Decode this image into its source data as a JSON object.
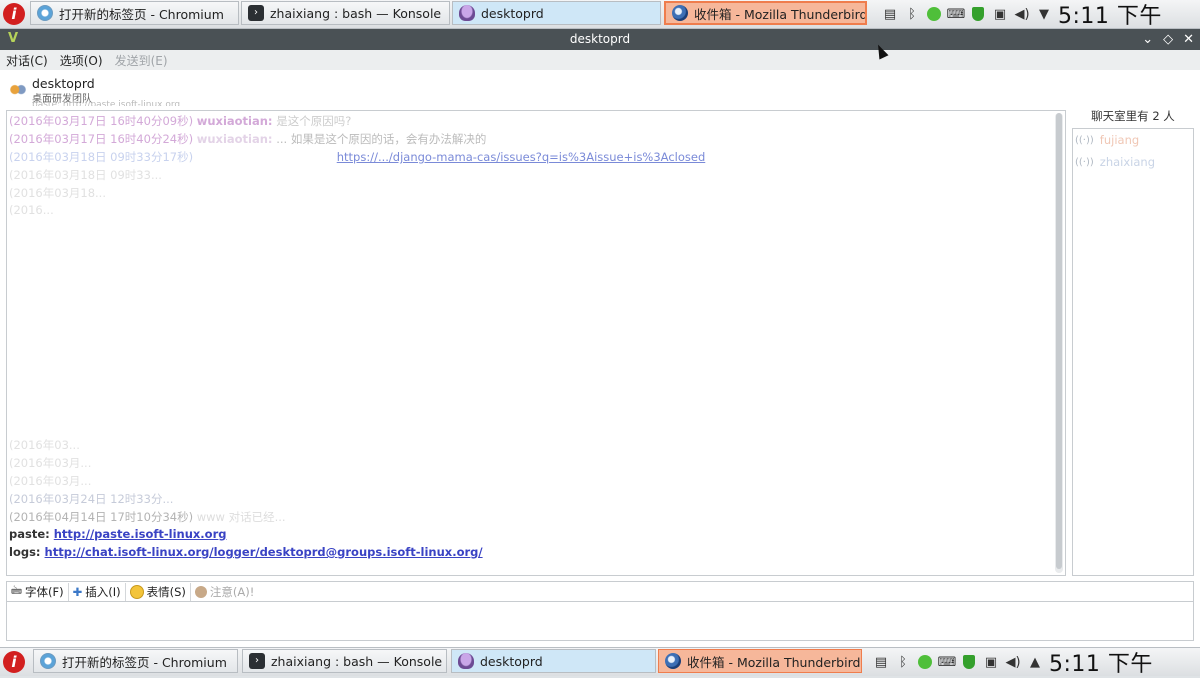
{
  "taskbar": {
    "tasks": [
      {
        "label": "打开新的标签页 - Chromium",
        "icon": "chromium-icon"
      },
      {
        "label": "zhaixiang : bash — Konsole",
        "icon": "konsole-icon"
      },
      {
        "label": "desktoprd",
        "icon": "pidgin-icon"
      },
      {
        "label": "收件箱 - Mozilla Thunderbird",
        "icon": "thunderbird-icon"
      }
    ],
    "clock": "5:11 下午",
    "start_icon": "isoft-start-icon",
    "tray_icons": [
      "clipboard-icon",
      "bluetooth-icon",
      "network-status-icon",
      "keyboard-icon",
      "shield-icon",
      "display-icon",
      "volume-icon",
      "tray-expand-icon"
    ]
  },
  "window": {
    "title": "desktoprd",
    "menu": [
      "对话(C)",
      "选项(O)",
      "发送到(E)"
    ]
  },
  "conversation": {
    "name": "desktoprd",
    "group": "桌面研发团队",
    "topic_partial": "paste: http://paste.isoft-linux.org"
  },
  "messages": [
    {
      "time": "(2016年03月17日 16时40分09秒)",
      "nick": "wuxiaotian:",
      "text": "是这个原因吗?"
    },
    {
      "time": "(2016年03月17日 16时40分24秒)",
      "nick": "wuxiaotian:",
      "text": "... 如果是这个原因的话，会有办法解决的"
    },
    {
      "time": "(2016年03月18日 09时33分17秒)",
      "nick": "",
      "text": "https://.../django-mama-cas/issues?q=is%3Aissue+is%3Aclosed"
    },
    {
      "time": "(2016年03月18日 09时33...",
      "nick": "",
      "text": ""
    },
    {
      "time": "(2016年03月18...",
      "nick": "",
      "text": ""
    },
    {
      "time": "(2016...",
      "nick": "",
      "text": ""
    }
  ],
  "messages_lower": [
    {
      "time": "(2016年03...",
      "text": ""
    },
    {
      "time": "(2016年03月...",
      "text": ""
    },
    {
      "time": "(2016年03月...",
      "text": ""
    },
    {
      "time": "(2016年03月24日 12时33分...",
      "text": ""
    },
    {
      "time": "(2016年04月14日 17时10分34秒)",
      "text": "www 对话已经..."
    }
  ],
  "info": {
    "paste_label": "paste:",
    "paste_url": "http://paste.isoft-linux.org",
    "logs_label": "logs:",
    "logs_url": "http://chat.isoft-linux.org/logger/desktoprd@groups.isoft-linux.org/"
  },
  "roster": {
    "header": "聊天室里有 2 人",
    "members": [
      "fujiang",
      "zhaixiang"
    ]
  },
  "compose_toolbar": {
    "font": "字体(F)",
    "insert": "插入(I)",
    "smiley": "表情(S)",
    "attention": "注意(A)!"
  }
}
